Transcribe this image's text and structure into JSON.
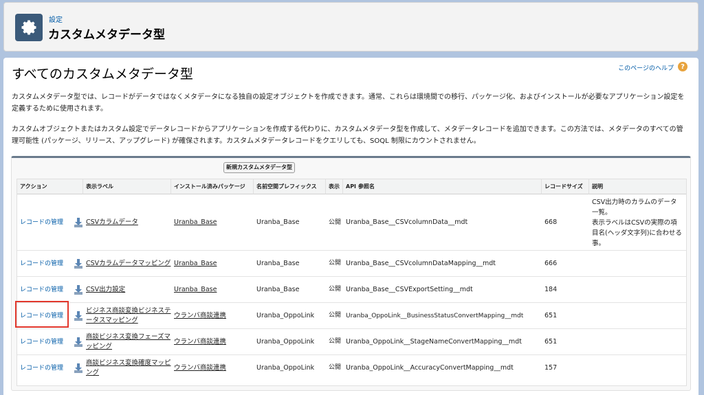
{
  "header": {
    "breadcrumb": "設定",
    "title": "カスタムメタデータ型",
    "icon": "gear-icon"
  },
  "page": {
    "title": "すべてのカスタムメタデータ型",
    "help_link": "このページのヘルプ",
    "help_icon": "?",
    "paragraph1": "カスタムメタデータ型では、レコードがデータではなくメタデータになる独自の設定オブジェクトを作成できます。通常、これらは環境間での移行、パッケージ化、およびインストールが必要なアプリケーション設定を定義するために使用されます。",
    "paragraph2": "カスタムオブジェクトまたはカスタム設定でデータレコードからアプリケーションを作成する代わりに、カスタムメタデータ型を作成して、メタデータレコードを追加できます。この方法では、メタデータのすべての管理可能性 (パッケージ、リリース、アップグレード) が確保されます。カスタムメタデータレコードをクエリしても、SOQL 制限にカウントされません。"
  },
  "new_button": "新規カスタムメタデータ型",
  "columns": [
    "アクション",
    "表示ラベル",
    "インストール済みパッケージ",
    "名前空間プレフィックス",
    "表示",
    "API 参照名",
    "レコードサイズ",
    "説明"
  ],
  "rows": [
    {
      "action": "レコードの管理",
      "label": "CSVカラムデータ",
      "package": "Uranba_Base",
      "prefix": "Uranba_Base",
      "visibility": "公開",
      "api": "Uranba_Base__CSVcolumnData__mdt",
      "size": "668",
      "desc": "CSV出力時のカラムのデータ一覧。\n表示ラベルはCSVの実際の項目名(ヘッダ文字列)に合わせる事。"
    },
    {
      "action": "レコードの管理",
      "label": "CSVカラムデータマッピング",
      "package": "Uranba_Base",
      "prefix": "Uranba_Base",
      "visibility": "公開",
      "api": "Uranba_Base__CSVcolumnDataMapping__mdt",
      "size": "666",
      "desc": ""
    },
    {
      "action": "レコードの管理",
      "label": "CSV出力設定",
      "package": "Uranba_Base",
      "prefix": "Uranba_Base",
      "visibility": "公開",
      "api": "Uranba_Base__CSVExportSetting__mdt",
      "size": "184",
      "desc": ""
    },
    {
      "action": "レコードの管理",
      "label": "ビジネス商談変換ビジネステータスマッピング",
      "package": "ウランバ商談連携",
      "prefix": "Uranba_OppoLink",
      "visibility": "公開",
      "api": "Uranba_OppoLink__BusinessStatusConvertMapping__mdt",
      "size": "651",
      "desc": ""
    },
    {
      "action": "レコードの管理",
      "label": "商談ビジネス変換フェーズマッピング",
      "package": "ウランバ商談連携",
      "prefix": "Uranba_OppoLink",
      "visibility": "公開",
      "api": "Uranba_OppoLink__StageNameConvertMapping__mdt",
      "size": "651",
      "desc": ""
    },
    {
      "action": "レコードの管理",
      "label": "商談ビジネス変換確度マッピング",
      "package": "ウランバ商談連携",
      "prefix": "Uranba_OppoLink",
      "visibility": "公開",
      "api": "Uranba_OppoLink__AccuracyConvertMapping__mdt",
      "size": "157",
      "desc": ""
    }
  ]
}
